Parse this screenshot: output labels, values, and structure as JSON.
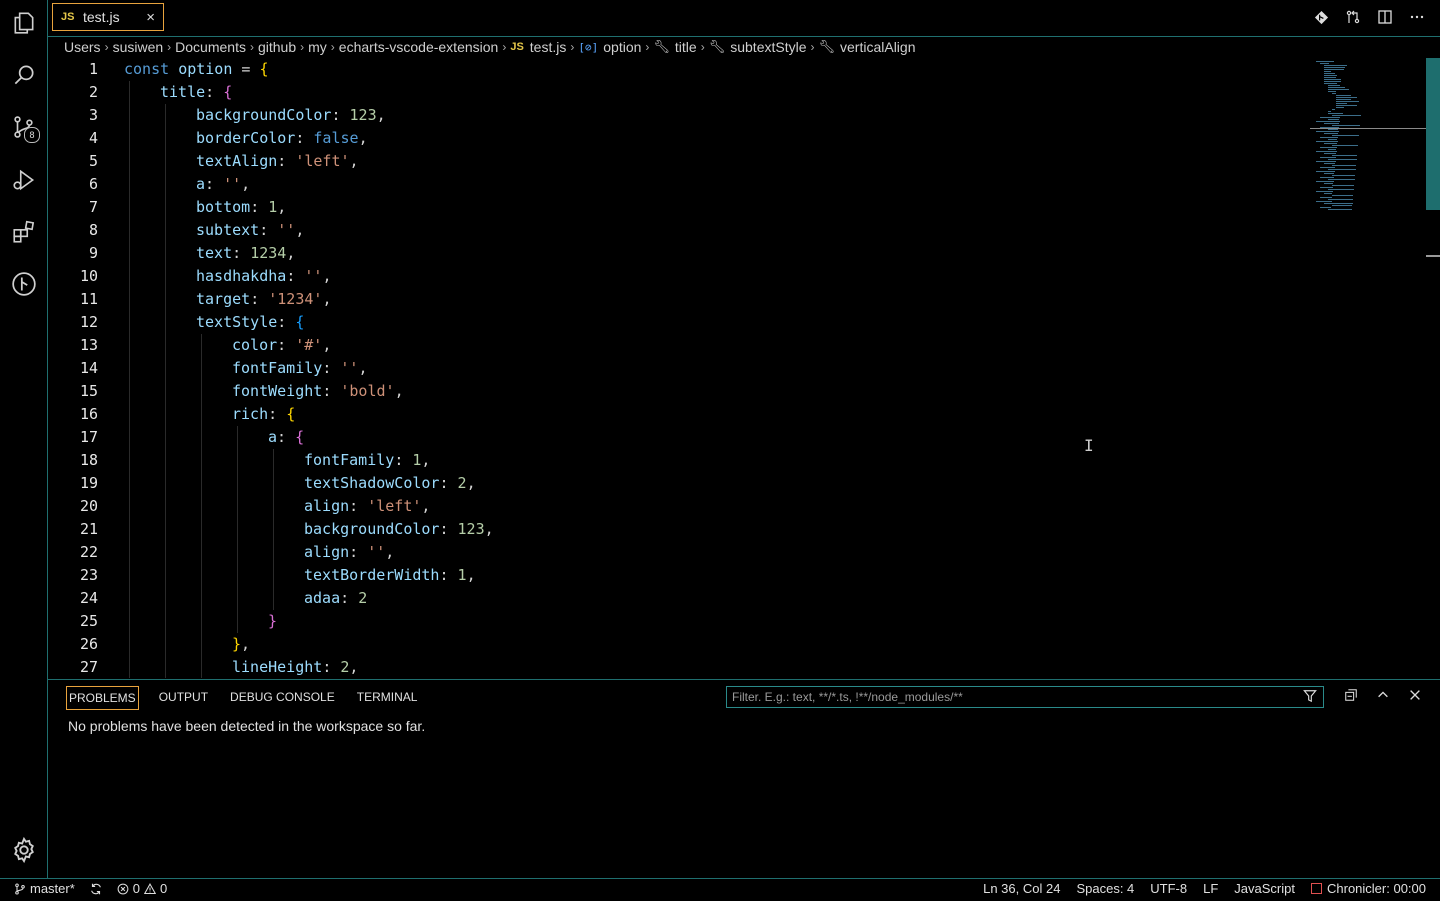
{
  "activity_bar": {
    "icons": [
      "explorer-icon",
      "search-icon",
      "source-control-icon",
      "run-debug-icon",
      "extensions-icon",
      "git-graph-icon"
    ],
    "source_control_badge": "8"
  },
  "tab": {
    "badge": "JS",
    "filename": "test.js",
    "close": "×"
  },
  "breadcrumb": [
    {
      "label": "Users",
      "kind": "folder"
    },
    {
      "label": "susiwen",
      "kind": "folder"
    },
    {
      "label": "Documents",
      "kind": "folder"
    },
    {
      "label": "github",
      "kind": "folder"
    },
    {
      "label": "my",
      "kind": "folder"
    },
    {
      "label": "echarts-vscode-extension",
      "kind": "folder"
    },
    {
      "label": "test.js",
      "kind": "file"
    },
    {
      "label": "option",
      "kind": "variable"
    },
    {
      "label": "title",
      "kind": "property"
    },
    {
      "label": "subtextStyle",
      "kind": "property"
    },
    {
      "label": "verticalAlign",
      "kind": "property"
    }
  ],
  "editor": {
    "lines": [
      {
        "n": "1",
        "indent": 0,
        "tokens": [
          [
            "k",
            "const "
          ],
          [
            "p",
            "option "
          ],
          [
            "d",
            "= "
          ],
          [
            "b1",
            "{"
          ]
        ]
      },
      {
        "n": "2",
        "indent": 1,
        "tokens": [
          [
            "p",
            "title"
          ],
          [
            "d",
            ": "
          ],
          [
            "b2",
            "{"
          ]
        ]
      },
      {
        "n": "3",
        "indent": 2,
        "tokens": [
          [
            "p",
            "backgroundColor"
          ],
          [
            "d",
            ": "
          ],
          [
            "n",
            "123"
          ],
          [
            "d",
            ","
          ]
        ]
      },
      {
        "n": "4",
        "indent": 2,
        "tokens": [
          [
            "p",
            "borderColor"
          ],
          [
            "d",
            ": "
          ],
          [
            "k",
            "false"
          ],
          [
            "d",
            ","
          ]
        ]
      },
      {
        "n": "5",
        "indent": 2,
        "tokens": [
          [
            "p",
            "textAlign"
          ],
          [
            "d",
            ": "
          ],
          [
            "s",
            "'left'"
          ],
          [
            "d",
            ","
          ]
        ]
      },
      {
        "n": "6",
        "indent": 2,
        "tokens": [
          [
            "p",
            "a"
          ],
          [
            "d",
            ": "
          ],
          [
            "s",
            "''"
          ],
          [
            "d",
            ","
          ]
        ]
      },
      {
        "n": "7",
        "indent": 2,
        "tokens": [
          [
            "p",
            "bottom"
          ],
          [
            "d",
            ": "
          ],
          [
            "n",
            "1"
          ],
          [
            "d",
            ","
          ]
        ]
      },
      {
        "n": "8",
        "indent": 2,
        "tokens": [
          [
            "p",
            "subtext"
          ],
          [
            "d",
            ": "
          ],
          [
            "s",
            "''"
          ],
          [
            "d",
            ","
          ]
        ]
      },
      {
        "n": "9",
        "indent": 2,
        "tokens": [
          [
            "p",
            "text"
          ],
          [
            "d",
            ": "
          ],
          [
            "n",
            "1234"
          ],
          [
            "d",
            ","
          ]
        ]
      },
      {
        "n": "10",
        "indent": 2,
        "tokens": [
          [
            "p",
            "hasdhakdha"
          ],
          [
            "d",
            ": "
          ],
          [
            "s",
            "''"
          ],
          [
            "d",
            ","
          ]
        ]
      },
      {
        "n": "11",
        "indent": 2,
        "tokens": [
          [
            "p",
            "target"
          ],
          [
            "d",
            ": "
          ],
          [
            "s",
            "'1234'"
          ],
          [
            "d",
            ","
          ]
        ]
      },
      {
        "n": "12",
        "indent": 2,
        "tokens": [
          [
            "p",
            "textStyle"
          ],
          [
            "d",
            ": "
          ],
          [
            "b3",
            "{"
          ]
        ]
      },
      {
        "n": "13",
        "indent": 3,
        "tokens": [
          [
            "p",
            "color"
          ],
          [
            "d",
            ": "
          ],
          [
            "s",
            "'#'"
          ],
          [
            "d",
            ","
          ]
        ]
      },
      {
        "n": "14",
        "indent": 3,
        "tokens": [
          [
            "p",
            "fontFamily"
          ],
          [
            "d",
            ": "
          ],
          [
            "s",
            "''"
          ],
          [
            "d",
            ","
          ]
        ]
      },
      {
        "n": "15",
        "indent": 3,
        "tokens": [
          [
            "p",
            "fontWeight"
          ],
          [
            "d",
            ": "
          ],
          [
            "s",
            "'bold'"
          ],
          [
            "d",
            ","
          ]
        ]
      },
      {
        "n": "16",
        "indent": 3,
        "tokens": [
          [
            "p",
            "rich"
          ],
          [
            "d",
            ": "
          ],
          [
            "b1",
            "{"
          ]
        ]
      },
      {
        "n": "17",
        "indent": 4,
        "tokens": [
          [
            "p",
            "a"
          ],
          [
            "d",
            ": "
          ],
          [
            "b2",
            "{"
          ]
        ]
      },
      {
        "n": "18",
        "indent": 5,
        "tokens": [
          [
            "p",
            "fontFamily"
          ],
          [
            "d",
            ": "
          ],
          [
            "n",
            "1"
          ],
          [
            "d",
            ","
          ]
        ]
      },
      {
        "n": "19",
        "indent": 5,
        "tokens": [
          [
            "p",
            "textShadowColor"
          ],
          [
            "d",
            ": "
          ],
          [
            "n",
            "2"
          ],
          [
            "d",
            ","
          ]
        ]
      },
      {
        "n": "20",
        "indent": 5,
        "tokens": [
          [
            "p",
            "align"
          ],
          [
            "d",
            ": "
          ],
          [
            "s",
            "'left'"
          ],
          [
            "d",
            ","
          ]
        ]
      },
      {
        "n": "21",
        "indent": 5,
        "tokens": [
          [
            "p",
            "backgroundColor"
          ],
          [
            "d",
            ": "
          ],
          [
            "n",
            "123"
          ],
          [
            "d",
            ","
          ]
        ]
      },
      {
        "n": "22",
        "indent": 5,
        "tokens": [
          [
            "p",
            "align"
          ],
          [
            "d",
            ": "
          ],
          [
            "s",
            "''"
          ],
          [
            "d",
            ","
          ]
        ]
      },
      {
        "n": "23",
        "indent": 5,
        "tokens": [
          [
            "p",
            "textBorderWidth"
          ],
          [
            "d",
            ": "
          ],
          [
            "n",
            "1"
          ],
          [
            "d",
            ","
          ]
        ]
      },
      {
        "n": "24",
        "indent": 5,
        "tokens": [
          [
            "p",
            "adaa"
          ],
          [
            "d",
            ": "
          ],
          [
            "n",
            "2"
          ]
        ]
      },
      {
        "n": "25",
        "indent": 4,
        "tokens": [
          [
            "b2",
            "}"
          ]
        ]
      },
      {
        "n": "26",
        "indent": 3,
        "tokens": [
          [
            "b1",
            "}"
          ],
          [
            "d",
            ","
          ]
        ]
      },
      {
        "n": "27",
        "indent": 3,
        "tokens": [
          [
            "p",
            "lineHeight"
          ],
          [
            "d",
            ": "
          ],
          [
            "n",
            "2"
          ],
          [
            "d",
            ","
          ]
        ]
      }
    ]
  },
  "panel": {
    "tabs": [
      "PROBLEMS",
      "OUTPUT",
      "DEBUG CONSOLE",
      "TERMINAL"
    ],
    "active_tab": "PROBLEMS",
    "filter_placeholder": "Filter. E.g.: text, **/*.ts, !**/node_modules/**",
    "message": "No problems have been detected in the workspace so far."
  },
  "status_bar": {
    "branch": "master*",
    "errors": "0",
    "warnings": "0",
    "cursor_position": "Ln 36, Col 24",
    "indentation": "Spaces: 4",
    "encoding": "UTF-8",
    "line_ending": "LF",
    "language": "JavaScript",
    "chronicler": "Chronicler: 00:00"
  },
  "colors": {
    "accent_border": "#1f6f6f",
    "active_tab_border": "#e8a33d",
    "keyword": "#569cd6",
    "property": "#9cdcfe",
    "string": "#ce9178",
    "number": "#b5cea8"
  }
}
